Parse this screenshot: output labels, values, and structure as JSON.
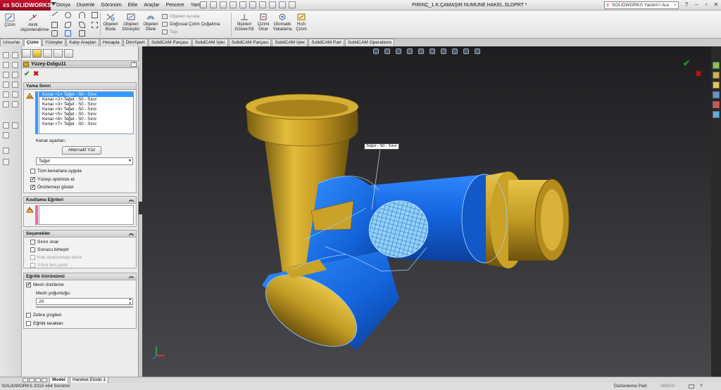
{
  "app": {
    "logo": "SOLIDWORKS",
    "document_title": "PIRINÇ_1.K.ÇAMAŞIR NUMUNE HAKEL.SLDPRT *",
    "help_search_placeholder": "SOLIDWORKS Yardım'ı Ara"
  },
  "menu": [
    "Dosya",
    "Düzenle",
    "Görünüm",
    "Ekle",
    "Araçlar",
    "Pencere",
    "Yardım"
  ],
  "ribbon": {
    "sketch": "Çizim",
    "smart_dimension": "Akıllı ölçümlendirme",
    "convert_entities": "Objeleri Buda",
    "trim": "Objeleri Dönüştür",
    "offset": "Objeleri Ötele",
    "mirror": "Objeleri Aynala",
    "linear_pattern": "Doğrusal Çizim Çoğaltma",
    "move": "Taşı",
    "relations": "İlişkileri Göster/Sil",
    "repair": "Çizimi Onar",
    "quick_snaps": "Otomatik Yakalama",
    "rapid_sketch": "Hızlı Çizim"
  },
  "command_tabs": [
    "Unsurlar",
    "Çizim",
    "Yüzeyler",
    "Kalıp Araçları",
    "Hesapla",
    "DimXpert",
    "SOLIDWORKS Eklentileri",
    "SolidCAM Parçası",
    "SolidCAM İşler",
    "SolidCAM Parçası",
    "SolidCAM İşler",
    "SolidCAM Part",
    "SolidCAM Operations"
  ],
  "command_tabs_visible": [
    "Unsurlar",
    "Çizim",
    "Yüzeyler",
    "Kalıp Araçları",
    "Hesapla",
    "DimXpert",
    "SolidCAM Parçası",
    "SolidCAM İşler",
    "SolidCAM Parçası",
    "SolidCAM İşler",
    "SolidCAM Part",
    "SolidCAM Operations"
  ],
  "property_manager": {
    "title": "Yüzey-Dolgu11",
    "help": "?",
    "patch_boundary": {
      "header": "Yama Sınırı",
      "edges": [
        "Kenar <1> Teğet - S0 - Sınır",
        "Kenar <2> Teğet - S0 - Sınır",
        "Kenar <3> Teğet - S0 - Sınır",
        "Kenar <4> Teğet - S0 - Sınır",
        "Kenar <5> Teğet - S0 - Sınır",
        "Kenar <6> Teğet - S0 - Sınır",
        "Kenar <7> Teğet - S0 - Sınır"
      ],
      "edge_settings_label": "Kenar ayarları:",
      "alternate_face_button": "Alternatif Yüz",
      "curvature_control": "Teğet",
      "apply_all_edges": "Tüm kenarlara uygula",
      "optimize_surface": "Yüzeyi optimize et",
      "show_preview": "Önizlemeyi göster"
    },
    "constraint_curves": {
      "header": "Kısıtlama Eğrileri"
    },
    "options": {
      "header": "Seçenekler",
      "fix_up_boundary": "Sınırı onar",
      "merge_result": "Sonucu birleştir",
      "try_to_form_solid": "Katı oluşturmayı dene",
      "reverse_direction": "Yönü ters çevir"
    },
    "curvature_display": {
      "header": "Eğrilik Görünümü",
      "mesh_preview": "Mesh önizleme",
      "mesh_density_label": "Mesh yoğunluğu:",
      "mesh_density_value": "20",
      "zebra_stripes": "Zebra çizgileri",
      "curvature_combs": "Eğrilik tarakları"
    }
  },
  "viewport": {
    "callout": "Teğet - S0 - Sınır"
  },
  "bottom_tabs": [
    "Model",
    "Hareket Etüdü 1"
  ],
  "status": {
    "version": "SOLIDWORKS 2015 x64 Sürümü",
    "mode": "Düzenleme Part",
    "units": "MMGS"
  },
  "colors": {
    "gold": "#c9a227",
    "blue": "#1a6ee6",
    "viewport_bg_top": "#1f1f22",
    "viewport_bg_bottom": "#46464a",
    "selection": "#3399ff"
  }
}
